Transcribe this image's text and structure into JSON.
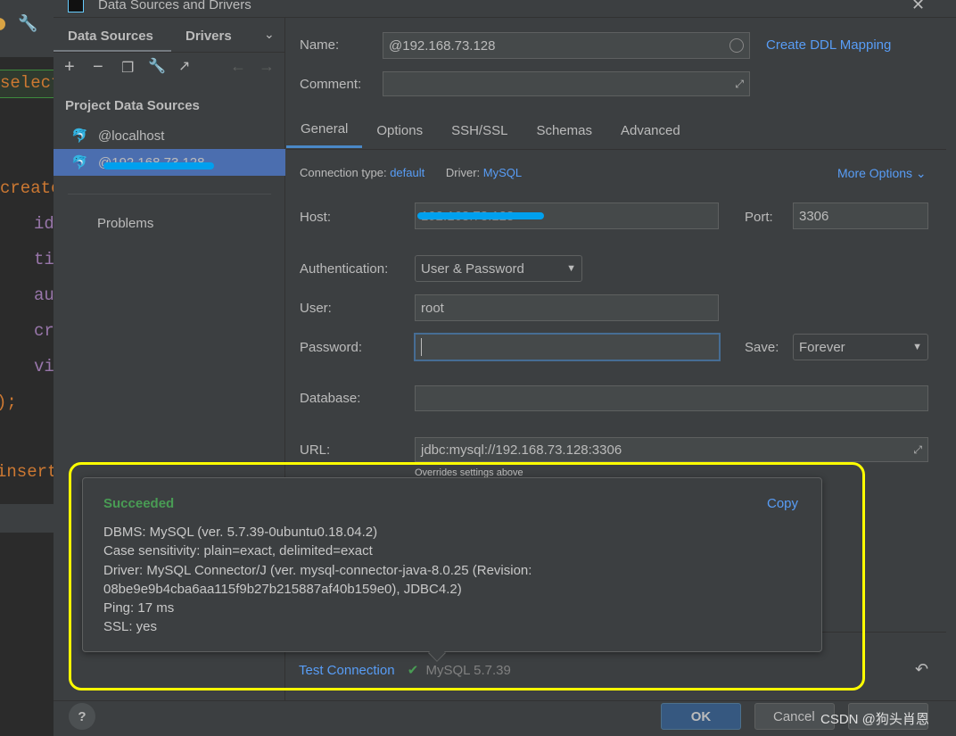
{
  "editor": {
    "lines": [
      "select",
      "create",
      "id",
      "ti",
      "au",
      "cr",
      "vi",
      ");",
      "insert"
    ]
  },
  "dialog": {
    "title": "Data Sources and Drivers",
    "close_icon": "close-icon"
  },
  "left": {
    "tabs": [
      "Data Sources",
      "Drivers"
    ],
    "section": "Project Data Sources",
    "items": [
      "@localhost",
      "@192.168.73.128"
    ],
    "problems": "Problems"
  },
  "right": {
    "name_label": "Name:",
    "name_value": "@192.168.73.128",
    "ddl_link": "Create DDL Mapping",
    "comment_label": "Comment:",
    "tabs": [
      "General",
      "Options",
      "SSH/SSL",
      "Schemas",
      "Advanced"
    ],
    "conn_type_label": "Connection type:",
    "conn_type": "default",
    "driver_label": "Driver:",
    "driver": "MySQL",
    "more_options": "More Options",
    "host_label": "Host:",
    "host_value": "192.168.73.128",
    "port_label": "Port:",
    "port_value": "3306",
    "auth_label": "Authentication:",
    "auth_value": "User & Password",
    "user_label": "User:",
    "user_value": "root",
    "password_label": "Password:",
    "save_label": "Save:",
    "save_value": "Forever",
    "database_label": "Database:",
    "url_label": "URL:",
    "url_value": "jdbc:mysql://192.168.73.128:3306",
    "url_hint": "Overrides settings above"
  },
  "popup": {
    "status": "Succeeded",
    "copy": "Copy",
    "lines": [
      "DBMS: MySQL (ver. 5.7.39-0ubuntu0.18.04.2)",
      "Case sensitivity: plain=exact, delimited=exact",
      "Driver: MySQL Connector/J (ver. mysql-connector-java-8.0.25 (Revision:",
      "08be9e9b4cba6aa115f9b27b215887af40b159e0), JDBC4.2)",
      "Ping: 17 ms",
      "SSL: yes"
    ]
  },
  "footer": {
    "test_connection": "Test Connection",
    "version": "MySQL 5.7.39",
    "ok": "OK",
    "cancel": "Cancel",
    "watermark": "CSDN @狗头肖恩"
  },
  "colors": {
    "accent": "#589df6",
    "success": "#499c54",
    "highlight": "#ffff00",
    "selection": "#4b6eaf"
  }
}
